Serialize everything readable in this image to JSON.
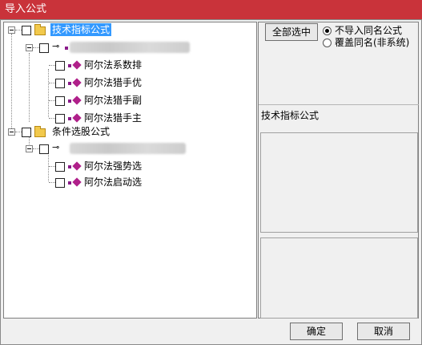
{
  "window": {
    "title": "导入公式"
  },
  "tree": {
    "groups": [
      {
        "label": "技术指标公式",
        "selected": true,
        "items": [
          "阿尔法系数排",
          "阿尔法猎手优",
          "阿尔法猎手副",
          "阿尔法猎手主"
        ]
      },
      {
        "label": "条件选股公式",
        "selected": false,
        "items": [
          "阿尔法强势选",
          "阿尔法启动选"
        ]
      }
    ]
  },
  "right": {
    "select_all_label": "全部选中",
    "options": [
      "不导入同名公式",
      "覆盖同名(非系统)"
    ],
    "selected_option": 0,
    "info_label": "技术指标公式"
  },
  "buttons": {
    "ok": "确定",
    "cancel": "取消"
  },
  "colors": {
    "title_bar": "#c9333a",
    "selection": "#3399ff",
    "item_icon": "#b0208a"
  }
}
